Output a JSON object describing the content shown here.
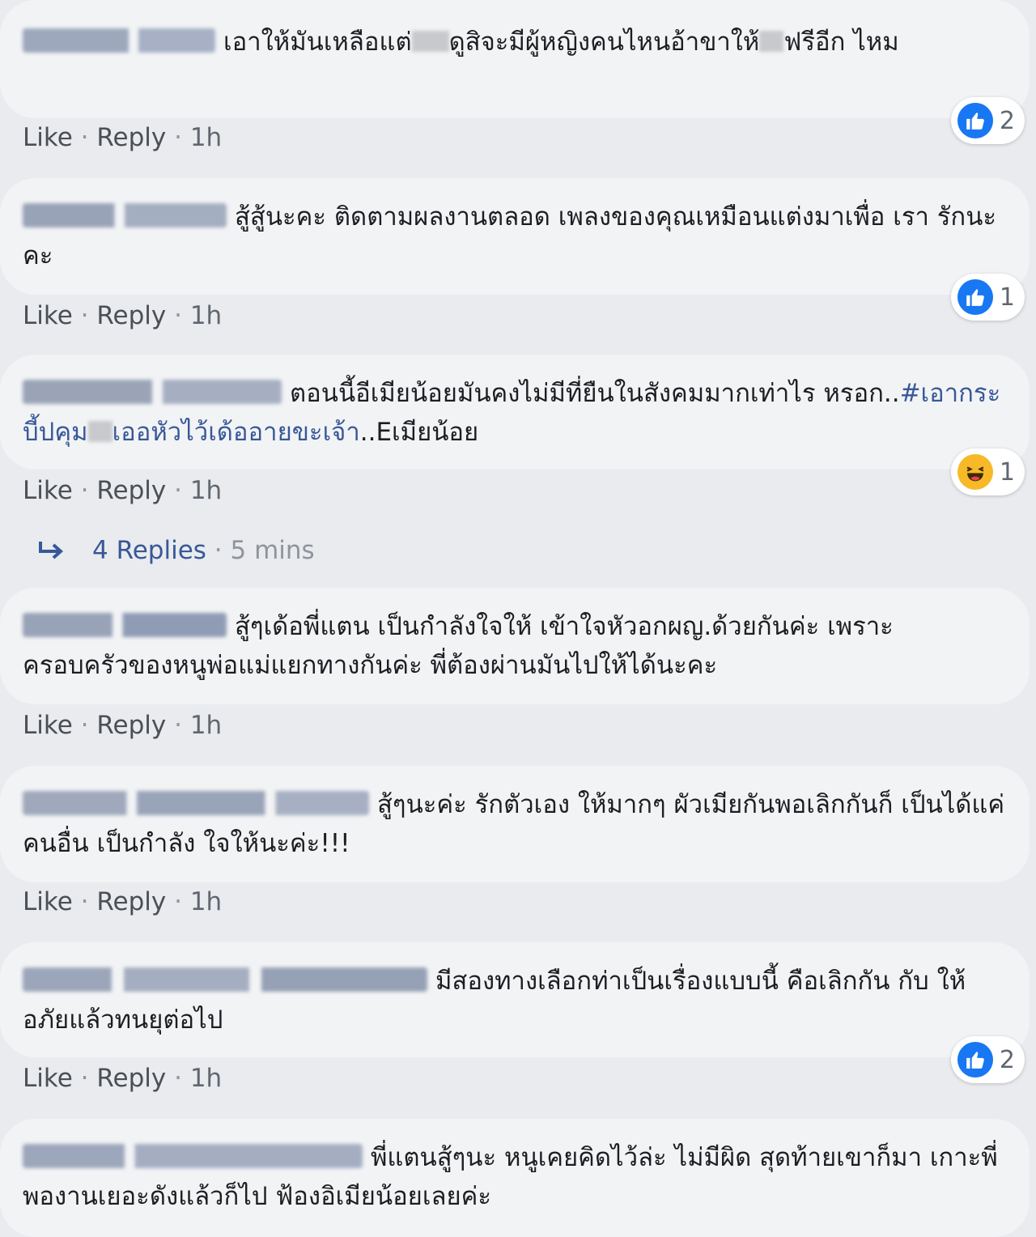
{
  "colors": {
    "background": "#e9ebee",
    "bubble": "#f2f3f5",
    "text": "#1c1e21",
    "link": "#385898",
    "meta": "#606770",
    "like_blue": "#1877f2",
    "haha_yellow": "#f7b928"
  },
  "actions": {
    "like": "Like",
    "reply": "Reply",
    "separator": "·"
  },
  "comments": [
    {
      "text_a": "เอาให้มันเหลือแต่",
      "text_b": "ดูสิจะมีผู้หญิงคนไหนอ้าขาให้",
      "text_c": "ฟรีอีก ไหม",
      "time": "1h",
      "reaction": {
        "icon": "like-icon",
        "count": "2"
      }
    },
    {
      "text": "สู้สู้นะคะ ติดตามผลงานตลอด เพลงของคุณเหมือนแต่งมาเพื่อ เรา รักนะคะ",
      "time": "1h",
      "reaction": {
        "icon": "like-icon",
        "count": "1"
      }
    },
    {
      "text_a": "ตอนนี้อีเมียน้อยมันคงไม่มีที่ยืนในสังคมมากเท่าไร หรอก..",
      "hashtag_a": "#เอากระบี้ปคุม",
      "hashtag_b": "เออหัวไว้เด้ออายขะเจ้า",
      "text_b": "..Eเมียน้อย",
      "time": "1h",
      "reaction": {
        "icon": "haha-icon",
        "count": "1"
      },
      "replies": {
        "label": "4 Replies",
        "time": "5 mins"
      }
    },
    {
      "text": "สู้ๆเด้อพี่แตน เป็นกำลังใจให้ เข้าใจหัวอกผญ.ด้วยกันค่ะ เพราะ ครอบครัวของหนูพ่อแม่แยกทางกันค่ะ พี่ต้องผ่านมันไปให้ได้นะคะ",
      "time": "1h"
    },
    {
      "text": "สู้ๆนะค่ะ รักตัวเอง ให้มากๆ ผัวเมียกันพอเลิกกันก็ เป็นได้แค่คนอื่น เป็นกำลัง ใจให้นะค่ะ!!!",
      "time": "1h"
    },
    {
      "text": "มีสองทางเลือกท่าเป็นเรื่องแบบนี้ คือเลิกกัน กับ ให้อภัยแล้วทนยุต่อไป",
      "time": "1h",
      "reaction": {
        "icon": "like-icon",
        "count": "2"
      }
    },
    {
      "text": "พี่แตนสู้ๆนะ หนูเคยคิดไว้ล่ะ ไม่มีผิด สุดท้ายเขาก็มา เกาะพี่ พองานเยอะดังแล้วก็ไป ฟ้องอิเมียน้อยเลยค่ะ"
    }
  ]
}
